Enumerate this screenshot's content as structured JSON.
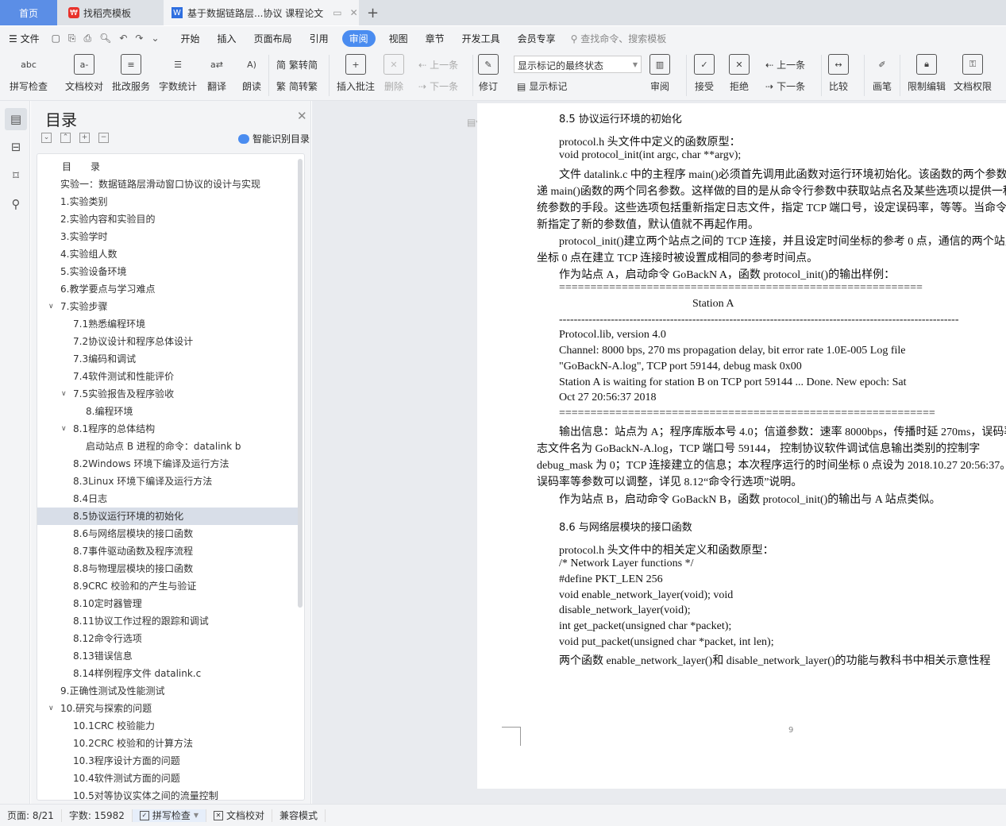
{
  "tabs": {
    "home": "首页",
    "template": "找稻壳模板",
    "doc": "基于数据链路层...协议 课程论文",
    "new_tab": "+"
  },
  "menu": {
    "file": "文件",
    "items": [
      "开始",
      "插入",
      "页面布局",
      "引用",
      "审阅",
      "视图",
      "章节",
      "开发工具",
      "会员专享"
    ],
    "active": "审阅",
    "search_placeholder": "查找命令、搜索模板"
  },
  "ribbon": {
    "spell": "拼写检查",
    "proof": "文档校对",
    "correct": "批改服务",
    "wordcount": "字数统计",
    "translate": "翻译",
    "read": "朗读",
    "trad2simp": "繁转简",
    "simp2trad": "简转繁",
    "insert_comment": "插入批注",
    "delete": "删除",
    "prev_c": "上一条",
    "next_c": "下一条",
    "revise": "修订",
    "markup_state": "显示标记的最终状态",
    "show_markup": "显示标记",
    "review": "审阅",
    "accept": "接受",
    "reject": "拒绝",
    "prev": "上一条",
    "next": "下一条",
    "compare": "比较",
    "pen": "画笔",
    "restrict": "限制编辑",
    "perm": "文档权限",
    "more": "文"
  },
  "toc": {
    "title": "目录",
    "smart": "智能识别目录",
    "items": [
      {
        "t": "目　　录",
        "l": 0
      },
      {
        "t": "实验一：数据链路层滑动窗口协议的设计与实现",
        "l": 0
      },
      {
        "t": "1.实验类别",
        "l": 0
      },
      {
        "t": "2.实验内容和实验目的",
        "l": 0
      },
      {
        "t": "3.实验学时",
        "l": 0
      },
      {
        "t": "4.实验组人数",
        "l": 0
      },
      {
        "t": "5.实验设备环境",
        "l": 0
      },
      {
        "t": "6.教学要点与学习难点",
        "l": 0
      },
      {
        "t": "7.实验步骤",
        "l": 0,
        "e": 1
      },
      {
        "t": "7.1熟悉编程环境",
        "l": 1
      },
      {
        "t": "7.2协议设计和程序总体设计",
        "l": 1
      },
      {
        "t": "7.3编码和调试",
        "l": 1
      },
      {
        "t": "7.4软件测试和性能评价",
        "l": 1
      },
      {
        "t": "7.5实验报告及程序验收",
        "l": 1,
        "e": 1
      },
      {
        "t": "8.编程环境",
        "l": 2
      },
      {
        "t": "8.1程序的总体结构",
        "l": 1,
        "e": 1
      },
      {
        "t": "启动站点 B 进程的命令：datalink b",
        "l": 2
      },
      {
        "t": "8.2Windows 环境下编译及运行方法",
        "l": 1
      },
      {
        "t": "8.3Linux 环境下编译及运行方法",
        "l": 1
      },
      {
        "t": "8.4日志",
        "l": 1
      },
      {
        "t": "8.5协议运行环境的初始化",
        "l": 1,
        "s": 1
      },
      {
        "t": "8.6与网络层模块的接口函数",
        "l": 1
      },
      {
        "t": "8.7事件驱动函数及程序流程",
        "l": 1
      },
      {
        "t": "8.8与物理层模块的接口函数",
        "l": 1
      },
      {
        "t": "8.9CRC 校验和的产生与验证",
        "l": 1
      },
      {
        "t": "8.10定时器管理",
        "l": 1
      },
      {
        "t": "8.11协议工作过程的跟踪和调试",
        "l": 1
      },
      {
        "t": "8.12命令行选项",
        "l": 1
      },
      {
        "t": "8.13错误信息",
        "l": 1
      },
      {
        "t": "8.14样例程序文件 datalink.c",
        "l": 1
      },
      {
        "t": "9.正确性测试及性能测试",
        "l": 0
      },
      {
        "t": "10.研究与探索的问题",
        "l": 0,
        "e": 1
      },
      {
        "t": "10.1CRC 校验能力",
        "l": 1
      },
      {
        "t": "10.2CRC 校验和的计算方法",
        "l": 1
      },
      {
        "t": "10.3程序设计方面的问题",
        "l": 1
      },
      {
        "t": "10.4软件测试方面的问题",
        "l": 1
      },
      {
        "t": "10.5对等协议实体之间的流量控制",
        "l": 1
      }
    ]
  },
  "doc": {
    "lines": [
      {
        "t": "8.5 协议运行环境的初始化",
        "k": "h"
      },
      {
        "t": "protocol.h 头文件中定义的函数原型：",
        "k": "i"
      },
      {
        "t": "void protocol_init(int argc, char **argv);",
        "k": "i"
      },
      {
        "t": "文件 datalink.c 中的主程序 main()必须首先调用此函数对运行环境初始化。该函数的两个参数",
        "k": "i"
      },
      {
        "t": "递 main()函数的两个同名参数。这样做的目的是从命令行参数中获取站点名及某些选项以提供一种",
        "k": "n"
      },
      {
        "t": "统参数的手段。这些选项包括重新指定日志文件，指定 TCP 端口号，设定误码率，等等。当命令",
        "k": "n"
      },
      {
        "t": "新指定了新的参数值，默认值就不再起作用。",
        "k": "n"
      },
      {
        "t": "protocol_init()建立两个站点之间的 TCP 连接，并且设定时间坐标的参考 0 点，通信的两个站点",
        "k": "i"
      },
      {
        "t": "坐标 0 点在建立 TCP 连接时被设置成相同的参考时间点。",
        "k": "n"
      },
      {
        "t": "作为站点 A，启动命令 GoBackN A，函数 protocol_init()的输出样例：",
        "k": "i"
      },
      {
        "t": "==========================================================",
        "k": "i"
      },
      {
        "t": "Station A",
        "k": "c"
      },
      {
        "t": "------------------------------------------------------------------------------------------------------------",
        "k": "i"
      },
      {
        "t": "Protocol.lib, version 4.0",
        "k": "i"
      },
      {
        "t": "Channel: 8000 bps, 270 ms propagation delay, bit error rate 1.0E-005 Log file",
        "k": "i"
      },
      {
        "t": "\"GoBackN-A.log\", TCP port 59144, debug mask 0x00",
        "k": "i"
      },
      {
        "t": "Station A is waiting for station B on TCP port 59144 ... Done. New epoch: Sat",
        "k": "i"
      },
      {
        "t": "Oct 27 20:56:37 2018",
        "k": "i"
      },
      {
        "t": "============================================================",
        "k": "i"
      },
      {
        "t": "输出信息：站点为 A；程序库版本号 4.0；信道参数：速率 8000bps，传播时延 270ms，误码率 1",
        "k": "i"
      },
      {
        "t": "志文件名为  GoBackN-A.log，TCP 端口号 59144， 控制协议软件调试信息输出类别的控制字",
        "k": "n"
      },
      {
        "t": "debug_mask 为 0；TCP 连接建立的信息；本次程序运行的时间坐标 0 点设为 2018.10.27 20:56:37。",
        "k": "n"
      },
      {
        "t": "误码率等参数可以调整，详见 8.12“命令行选项”说明。",
        "k": "n"
      },
      {
        "t": "作为站点 B，启动命令 GoBackN B，函数 protocol_init()的输出与 A 站点类似。",
        "k": "i"
      },
      {
        "t": "8.6 与网络层模块的接口函数",
        "k": "h"
      },
      {
        "t": "protocol.h 头文件中的相关定义和函数原型：",
        "k": "i"
      },
      {
        "t": "/* Network Layer functions */",
        "k": "i"
      },
      {
        "t": "#define PKT_LEN 256",
        "k": "i"
      },
      {
        "t": "void enable_network_layer(void); void",
        "k": "i"
      },
      {
        "t": "disable_network_layer(void);",
        "k": "i"
      },
      {
        "t": "int    get_packet(unsigned char *packet);",
        "k": "i"
      },
      {
        "t": "void put_packet(unsigned char *packet, int len);",
        "k": "i"
      },
      {
        "t": "两个函数 enable_network_layer()和 disable_network_layer()的功能与教科书中相关示意性程",
        "k": "i"
      }
    ],
    "page_number": "9"
  },
  "status": {
    "page": "页面: 8/21",
    "words": "字数: 15982",
    "spell": "拼写检查",
    "proof": "文档校对",
    "compat": "兼容模式"
  }
}
